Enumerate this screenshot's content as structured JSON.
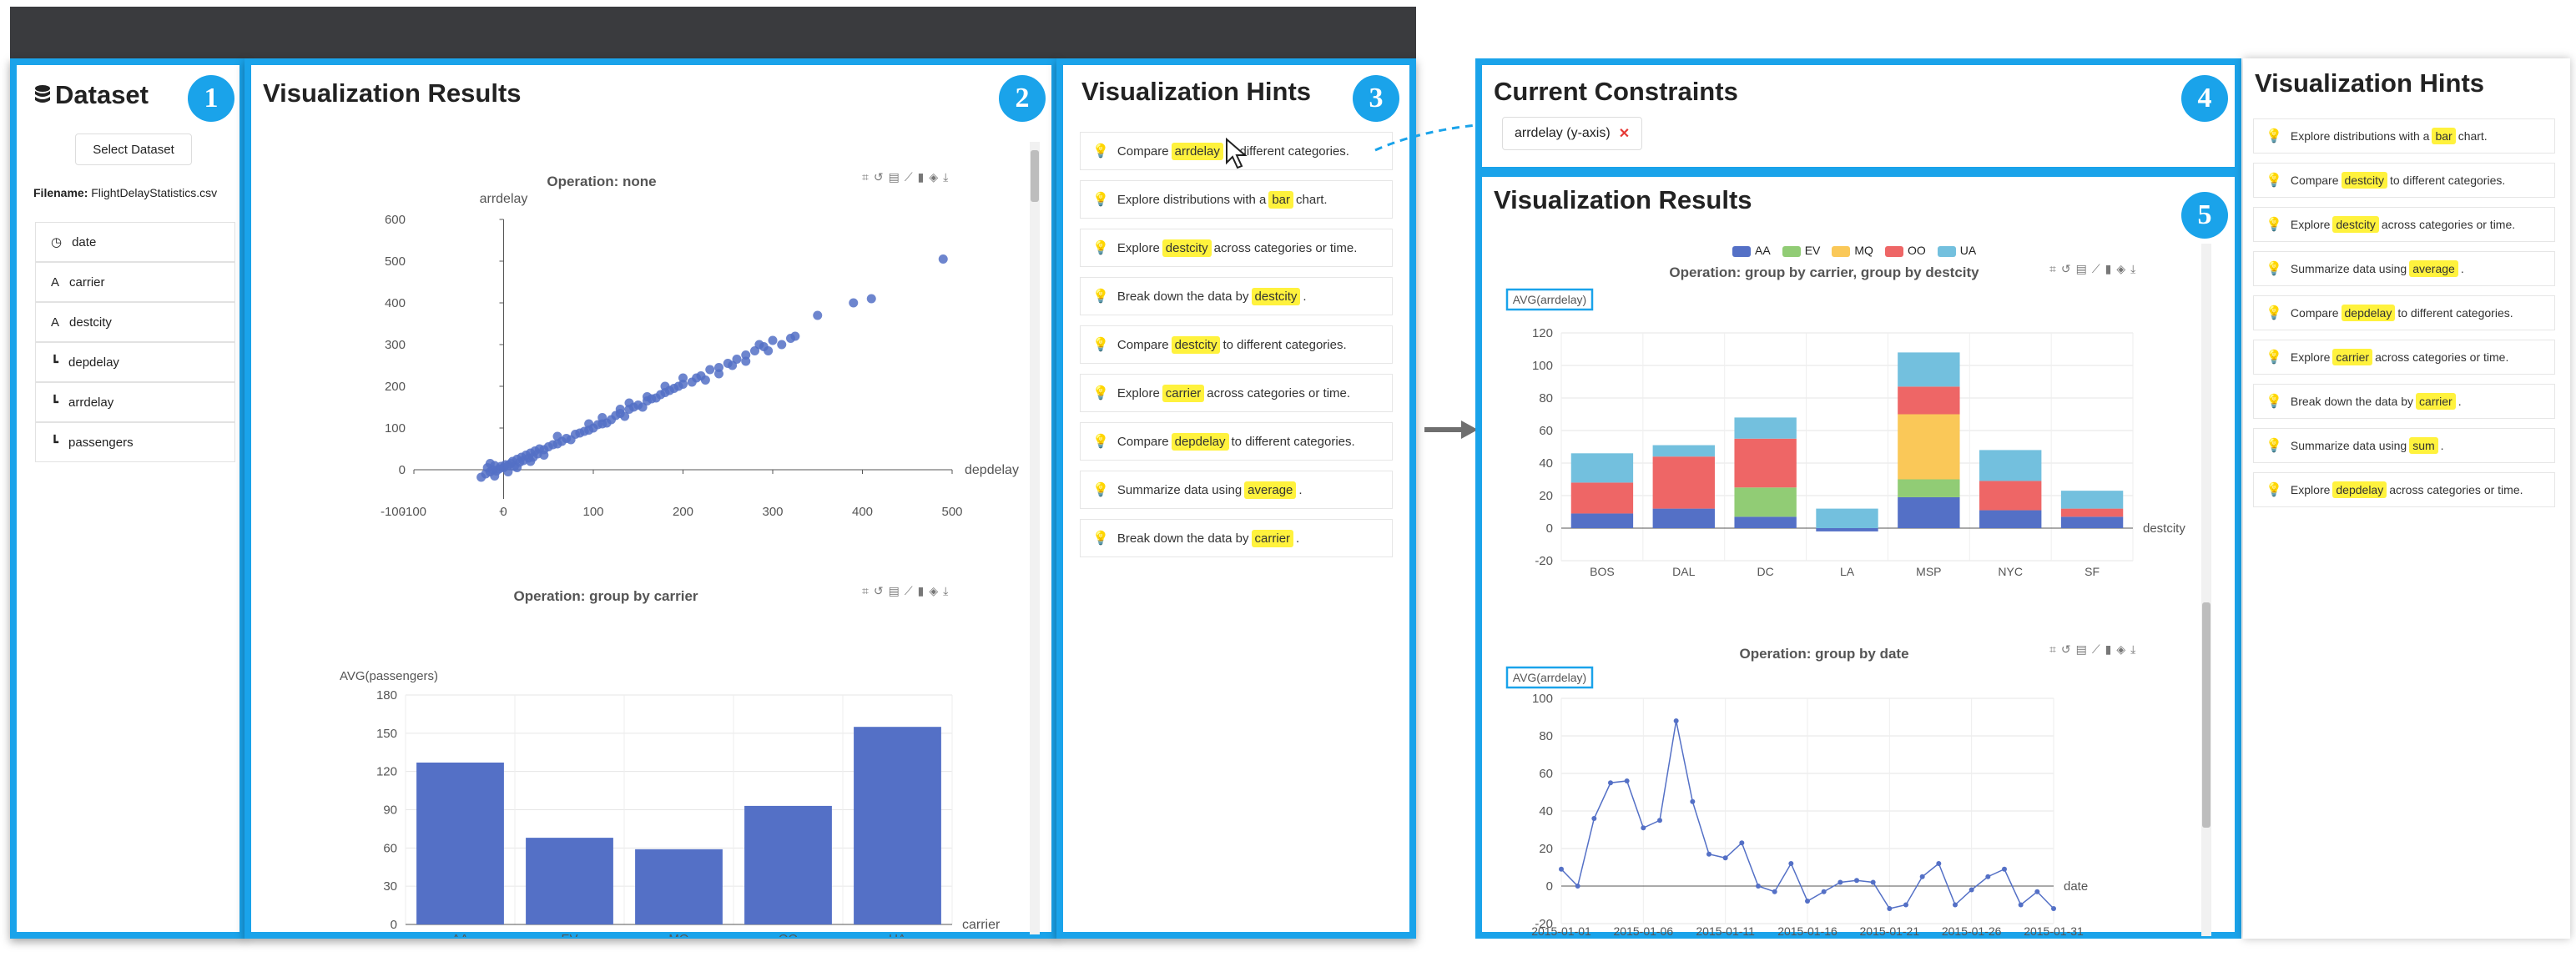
{
  "colors": {
    "accent": "#1aa3ea",
    "bar": "#5470c6",
    "topbar": "#3a3b3e",
    "highlight": "#fff23d",
    "series": {
      "AA": "#5470c6",
      "EV": "#91cc75",
      "MQ": "#fac858",
      "OO": "#ee6666",
      "UA": "#73c0de"
    }
  },
  "icons": {
    "db": "database-icon",
    "field": [
      "clock-icon",
      "text-icon",
      "text-icon",
      "bar-chart-icon",
      "bar-chart-icon",
      "bar-chart-icon"
    ],
    "bulb": "lightbulb-icon",
    "toolbox": [
      "zoom-icon",
      "zoom-reset-icon",
      "data-view-icon",
      "line-icon",
      "bar-icon",
      "stack-icon",
      "download-icon"
    ]
  },
  "dataset": {
    "title": "Dataset",
    "badge": "1",
    "select_button": "Select Dataset",
    "filename_label": "Filename:",
    "filename": "FlightDelayStatistics.csv",
    "fields": [
      "date",
      "carrier",
      "destcity",
      "depdelay",
      "arrdelay",
      "passengers"
    ]
  },
  "viz_left": {
    "title": "Visualization Results",
    "badge": "2"
  },
  "hints_left": {
    "title": "Visualization Hints",
    "badge": "3",
    "items": [
      {
        "pre": "Compare",
        "kw": "arrdelay",
        "post": "to different categories."
      },
      {
        "pre": "Explore distributions with a",
        "kw": "bar",
        "post": "chart."
      },
      {
        "pre": "Explore",
        "kw": "destcity",
        "post": "across categories or time."
      },
      {
        "pre": "Break down the data by",
        "kw": "destcity",
        "post": "."
      },
      {
        "pre": "Compare",
        "kw": "destcity",
        "post": "to different categories."
      },
      {
        "pre": "Explore",
        "kw": "carrier",
        "post": "across categories or time."
      },
      {
        "pre": "Compare",
        "kw": "depdelay",
        "post": "to different categories."
      },
      {
        "pre": "Summarize data using",
        "kw": "average",
        "post": "."
      },
      {
        "pre": "Break down the data by",
        "kw": "carrier",
        "post": "."
      }
    ]
  },
  "constraints": {
    "title": "Current Constraints",
    "badge": "4",
    "tag": "arrdelay (y-axis)",
    "remove": "✕"
  },
  "viz_right": {
    "title": "Visualization Results",
    "badge": "5"
  },
  "hints_right": {
    "title": "Visualization Hints",
    "items": [
      {
        "pre": "Explore distributions with a",
        "kw": "bar",
        "post": "chart."
      },
      {
        "pre": "Compare",
        "kw": "destcity",
        "post": "to different categories."
      },
      {
        "pre": "Explore",
        "kw": "destcity",
        "post": "across categories or time."
      },
      {
        "pre": "Summarize data using",
        "kw": "average",
        "post": "."
      },
      {
        "pre": "Compare",
        "kw": "depdelay",
        "post": "to different categories."
      },
      {
        "pre": "Explore",
        "kw": "carrier",
        "post": "across categories or time."
      },
      {
        "pre": "Break down the data by",
        "kw": "carrier",
        "post": "."
      },
      {
        "pre": "Summarize data using",
        "kw": "sum",
        "post": "."
      },
      {
        "pre": "Explore",
        "kw": "depdelay",
        "post": "across categories or time."
      }
    ]
  },
  "chart_data": [
    {
      "type": "scatter",
      "title": "Operation: none",
      "xlabel": "depdelay",
      "ylabel": "arrdelay",
      "xlim": [
        -100,
        500
      ],
      "ylim": [
        -100,
        600
      ],
      "xticks": [
        "-100",
        "0",
        "100",
        "200",
        "300",
        "400",
        "500"
      ],
      "yticks": [
        "-100",
        "0",
        "100",
        "200",
        "300",
        "400",
        "500",
        "600"
      ],
      "points": [
        [
          -25,
          -18
        ],
        [
          -20,
          -10
        ],
        [
          -18,
          5
        ],
        [
          -15,
          -5
        ],
        [
          -12,
          0
        ],
        [
          -10,
          10
        ],
        [
          -8,
          -3
        ],
        [
          -5,
          2
        ],
        [
          -3,
          8
        ],
        [
          0,
          5
        ],
        [
          2,
          12
        ],
        [
          5,
          10
        ],
        [
          8,
          15
        ],
        [
          10,
          20
        ],
        [
          12,
          8
        ],
        [
          15,
          25
        ],
        [
          18,
          18
        ],
        [
          20,
          30
        ],
        [
          22,
          22
        ],
        [
          25,
          35
        ],
        [
          28,
          28
        ],
        [
          30,
          40
        ],
        [
          33,
          30
        ],
        [
          35,
          45
        ],
        [
          38,
          38
        ],
        [
          40,
          50
        ],
        [
          45,
          48
        ],
        [
          50,
          55
        ],
        [
          55,
          60
        ],
        [
          60,
          62
        ],
        [
          65,
          68
        ],
        [
          70,
          75
        ],
        [
          75,
          72
        ],
        [
          80,
          85
        ],
        [
          85,
          88
        ],
        [
          90,
          92
        ],
        [
          95,
          95
        ],
        [
          100,
          100
        ],
        [
          105,
          108
        ],
        [
          110,
          110
        ],
        [
          115,
          112
        ],
        [
          120,
          120
        ],
        [
          125,
          130
        ],
        [
          130,
          135
        ],
        [
          135,
          128
        ],
        [
          140,
          145
        ],
        [
          145,
          150
        ],
        [
          150,
          155
        ],
        [
          155,
          150
        ],
        [
          160,
          165
        ],
        [
          165,
          170
        ],
        [
          170,
          172
        ],
        [
          175,
          180
        ],
        [
          180,
          185
        ],
        [
          185,
          190
        ],
        [
          190,
          195
        ],
        [
          195,
          200
        ],
        [
          200,
          205
        ],
        [
          210,
          210
        ],
        [
          215,
          220
        ],
        [
          220,
          225
        ],
        [
          225,
          215
        ],
        [
          230,
          240
        ],
        [
          240,
          245
        ],
        [
          250,
          255
        ],
        [
          255,
          250
        ],
        [
          260,
          265
        ],
        [
          270,
          275
        ],
        [
          280,
          285
        ],
        [
          290,
          295
        ],
        [
          295,
          285
        ],
        [
          300,
          310
        ],
        [
          310,
          300
        ],
        [
          320,
          315
        ],
        [
          325,
          320
        ],
        [
          350,
          370
        ],
        [
          390,
          400
        ],
        [
          410,
          410
        ],
        [
          490,
          505
        ],
        [
          140,
          160
        ],
        [
          160,
          175
        ],
        [
          200,
          220
        ],
        [
          60,
          80
        ],
        [
          30,
          20
        ],
        [
          15,
          5
        ],
        [
          -15,
          15
        ],
        [
          -10,
          -15
        ],
        [
          5,
          -5
        ],
        [
          45,
          35
        ],
        [
          95,
          110
        ],
        [
          110,
          125
        ],
        [
          130,
          145
        ],
        [
          180,
          200
        ],
        [
          240,
          230
        ],
        [
          270,
          260
        ],
        [
          285,
          300
        ]
      ]
    },
    {
      "type": "bar",
      "title": "Operation: group by carrier",
      "xlabel": "carrier",
      "ylabel": "AVG(passengers)",
      "categories": [
        "AA",
        "EV",
        "MQ",
        "OO",
        "UA"
      ],
      "values": [
        127,
        68,
        59,
        93,
        155
      ],
      "ylim": [
        0,
        180
      ],
      "yticks": [
        "0",
        "30",
        "60",
        "90",
        "120",
        "150",
        "180"
      ]
    },
    {
      "type": "bar",
      "stacked": true,
      "title": "Operation: group by carrier, group by destcity",
      "xlabel": "destcity",
      "ylabel": "AVG(arrdelay)",
      "categories": [
        "BOS",
        "DAL",
        "DC",
        "LA",
        "MSP",
        "NYC",
        "SF"
      ],
      "ylim": [
        -20,
        120
      ],
      "yticks": [
        "-20",
        "0",
        "20",
        "40",
        "60",
        "80",
        "100",
        "120"
      ],
      "legend": [
        "AA",
        "EV",
        "MQ",
        "OO",
        "UA"
      ],
      "series": [
        {
          "name": "AA",
          "values": [
            9,
            12,
            7,
            -2,
            19,
            11,
            7
          ]
        },
        {
          "name": "EV",
          "values": [
            0,
            0,
            18,
            0,
            11,
            0,
            0
          ]
        },
        {
          "name": "MQ",
          "values": [
            0,
            0,
            0,
            0,
            40,
            0,
            0
          ]
        },
        {
          "name": "OO",
          "values": [
            19,
            32,
            30,
            0,
            17,
            18,
            5
          ]
        },
        {
          "name": "UA",
          "values": [
            18,
            7,
            13,
            12,
            21,
            19,
            11
          ]
        }
      ]
    },
    {
      "type": "line",
      "title": "Operation: group by date",
      "xlabel": "date",
      "ylabel": "AVG(arrdelay)",
      "ylim": [
        -20,
        100
      ],
      "yticks": [
        "-20",
        "0",
        "20",
        "40",
        "60",
        "80",
        "100"
      ],
      "xticklabels": [
        "2015-01-01",
        "2015-01-06",
        "2015-01-11",
        "2015-01-16",
        "2015-01-21",
        "2015-01-26",
        "2015-01-31"
      ],
      "values": [
        9,
        0,
        36,
        55,
        56,
        31,
        35,
        88,
        45,
        17,
        15,
        23,
        0,
        -3,
        12,
        -8,
        -3,
        2,
        3,
        2,
        -12,
        -10,
        5,
        12,
        -10,
        -2,
        5,
        9,
        -10,
        -3,
        -12
      ]
    }
  ]
}
